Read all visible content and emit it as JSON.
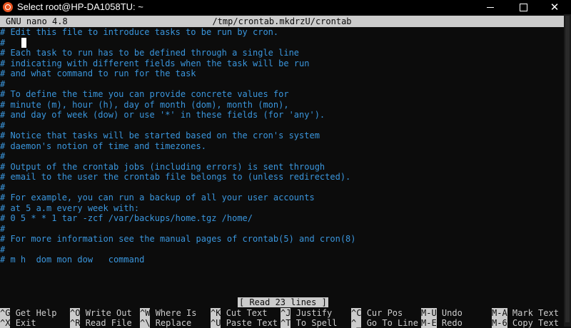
{
  "titlebar": {
    "title": "Select root@HP-DA1058TU: ~",
    "icon": "ubuntu-icon"
  },
  "nano": {
    "version": "GNU nano 4.8",
    "filename": "/tmp/crontab.mkdrzU/crontab"
  },
  "lines": [
    "# Edit this file to introduce tasks to be run by cron.",
    "#",
    "# Each task to run has to be defined through a single line",
    "# indicating with different fields when the task will be run",
    "# and what command to run for the task",
    "#",
    "# To define the time you can provide concrete values for",
    "# minute (m), hour (h), day of month (dom), month (mon),",
    "# and day of week (dow) or use '*' in these fields (for 'any').",
    "#",
    "# Notice that tasks will be started based on the cron's system",
    "# daemon's notion of time and timezones.",
    "#",
    "# Output of the crontab jobs (including errors) is sent through",
    "# email to the user the crontab file belongs to (unless redirected).",
    "#",
    "# For example, you can run a backup of all your user accounts",
    "# at 5 a.m every week with:",
    "# 0 5 * * 1 tar -zcf /var/backups/home.tgz /home/",
    "#",
    "# For more information see the manual pages of crontab(5) and cron(8)",
    "#",
    "# m h  dom mon dow   command"
  ],
  "status": "[ Read 23 lines ]",
  "shortcuts": [
    {
      "key": "^G",
      "label": "Get Help"
    },
    {
      "key": "^X",
      "label": "Exit"
    },
    {
      "key": "^O",
      "label": "Write Out"
    },
    {
      "key": "^R",
      "label": "Read File"
    },
    {
      "key": "^W",
      "label": "Where Is"
    },
    {
      "key": "^\\",
      "label": "Replace"
    },
    {
      "key": "^K",
      "label": "Cut Text"
    },
    {
      "key": "^U",
      "label": "Paste Text"
    },
    {
      "key": "^J",
      "label": "Justify"
    },
    {
      "key": "^T",
      "label": "To Spell"
    },
    {
      "key": "^C",
      "label": "Cur Pos"
    },
    {
      "key": "^_",
      "label": "Go To Line"
    },
    {
      "key": "M-U",
      "label": "Undo"
    },
    {
      "key": "M-E",
      "label": "Redo"
    },
    {
      "key": "M-A",
      "label": "Mark Text"
    },
    {
      "key": "M-6",
      "label": "Copy Text"
    }
  ],
  "colors": {
    "text": "#3a96dd",
    "background": "#0c0c0c",
    "inverse_bg": "#cccccc",
    "titlebar": "#000000",
    "ubuntu_orange": "#e95420"
  }
}
